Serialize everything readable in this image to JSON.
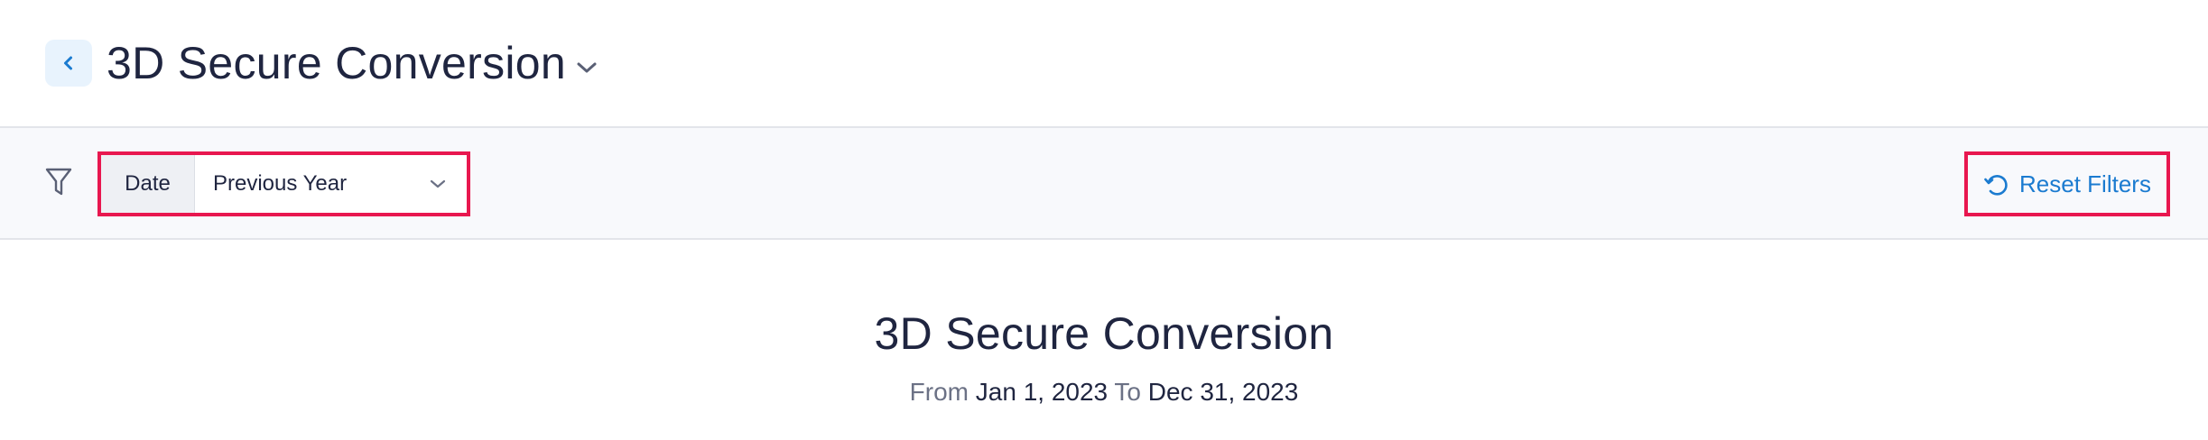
{
  "header": {
    "back_icon": "chevron-left-icon",
    "title": "3D Secure Conversion",
    "title_dropdown_icon": "chevron-down-icon"
  },
  "filters": {
    "filter_icon": "funnel-icon",
    "date": {
      "label": "Date",
      "value": "Previous Year",
      "dropdown_icon": "chevron-down-icon"
    },
    "reset": {
      "icon": "refresh-icon",
      "label": "Reset Filters"
    }
  },
  "report": {
    "title": "3D Secure Conversion",
    "range": {
      "from_label": "From",
      "from_date": "Jan 1, 2023",
      "to_label": "To",
      "to_date": "Dec 31, 2023"
    }
  },
  "colors": {
    "accent": "#1b7bd0",
    "highlight_border": "#e8174f",
    "text": "#1f2540",
    "muted_text": "#6b7185",
    "filter_bar_bg": "#f8f9fc"
  }
}
